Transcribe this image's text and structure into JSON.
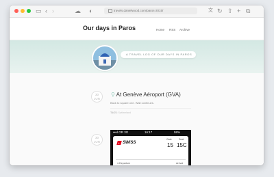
{
  "browser": {
    "url": "travels.danielwood.com/paros-2015/",
    "icons": [
      "sidebar-icon",
      "back-icon",
      "forward-icon",
      "cloud-icon",
      "privacy-icon",
      "lock-icon",
      "translate-icon",
      "reload-icon",
      "share-icon",
      "new-tab-icon",
      "tabs-icon"
    ]
  },
  "site": {
    "title": "Our days in Paros",
    "nav": [
      "Home",
      "RSS",
      "Archive"
    ],
    "tagline": "A TRAVEL LOG OF OUR DAYS IN PAROS",
    "accent": "#9ccfc2"
  },
  "posts": [
    {
      "day": "30",
      "month": "JUN",
      "title": "At Genève Aéroport (GVA)",
      "body": "Back to square one. Wait continues.",
      "tags_label": "TAGS:",
      "tags": "Switzerland"
    },
    {
      "day": "30",
      "month": "JUN",
      "phone_status": {
        "carrier": "•••ıl GR  3G",
        "time": "16:17",
        "battery": "58%"
      },
      "ticket": {
        "airline": "SWISS",
        "gate_label": "Gate",
        "gate": "15",
        "seat_label": "Seat",
        "seat": "15C",
        "departure_label": "Departure",
        "arrival_label": "Arrival"
      }
    }
  ]
}
